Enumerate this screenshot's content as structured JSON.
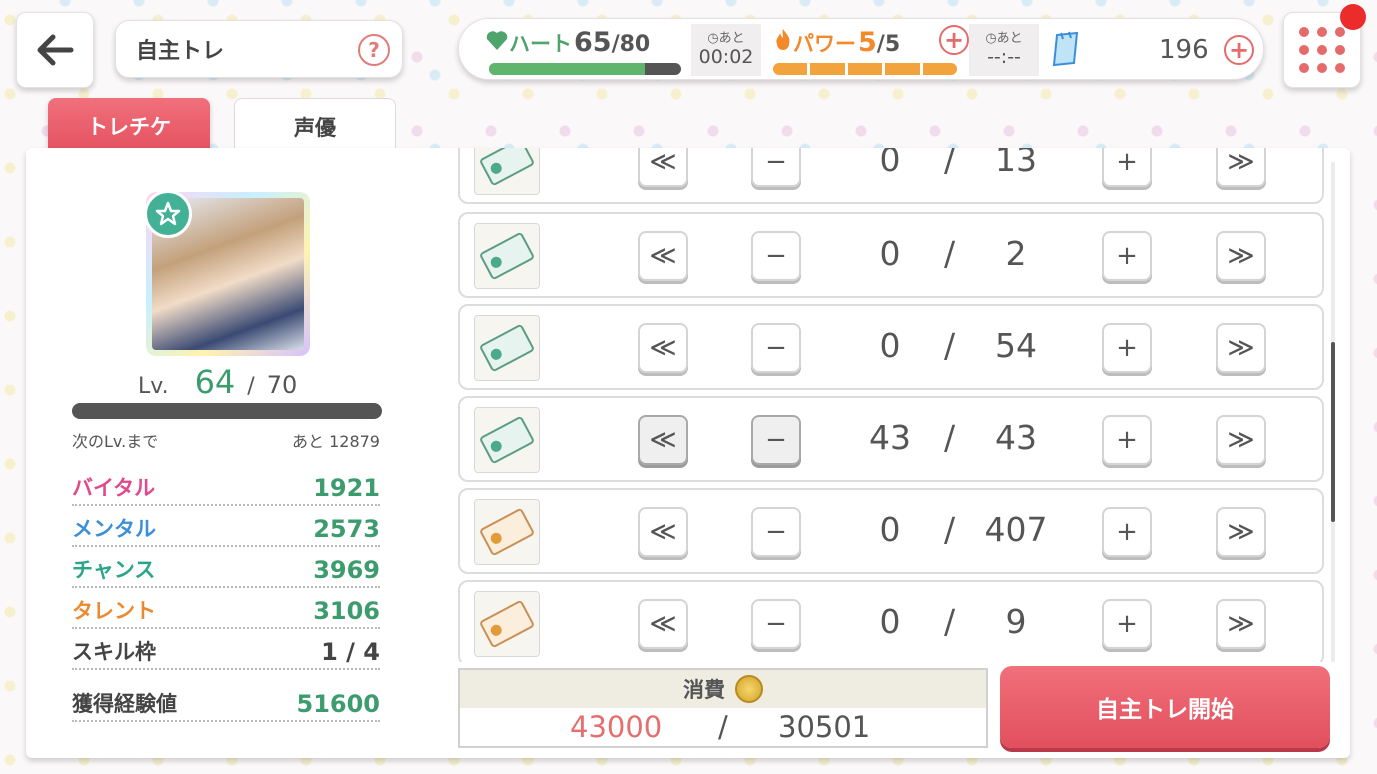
{
  "header": {
    "title": "自主トレ",
    "help_label": "?",
    "heart": {
      "label": "ハート",
      "current": "65",
      "max": "/80",
      "fill": 0.8125
    },
    "heart_timer": {
      "label": "あと",
      "time": "00:02"
    },
    "power": {
      "label": "パワー",
      "current": "5",
      "max": "/5",
      "segments": 5,
      "filled": 5
    },
    "power_timer": {
      "label": "あと",
      "time": "--:--"
    },
    "currency": "196",
    "plus_label": "+"
  },
  "tabs": [
    {
      "label": "トレチケ",
      "active": true
    },
    {
      "label": "声優",
      "active": false
    }
  ],
  "character": {
    "level_label": "Lv.",
    "level": "64",
    "level_sep": "/",
    "level_max": "70",
    "exp_fill": 0.0,
    "next_label": "次のLv.まで",
    "next_value": "あと 12879",
    "stats": [
      {
        "name": "バイタル",
        "value": "1921",
        "name_color": "#e0498b",
        "value_color": "#3d9c6d"
      },
      {
        "name": "メンタル",
        "value": "2573",
        "name_color": "#3b8fd9",
        "value_color": "#3d9c6d"
      },
      {
        "name": "チャンス",
        "value": "3969",
        "name_color": "#2aa58a",
        "value_color": "#3d9c6d"
      },
      {
        "name": "タレント",
        "value": "3106",
        "name_color": "#ea8a2e",
        "value_color": "#3d9c6d"
      },
      {
        "name": "スキル枠",
        "value": "1 / 4",
        "name_color": "#444444",
        "value_color": "#444444"
      },
      {
        "name": "獲得経験値",
        "value": "51600",
        "name_color": "#444444",
        "value_color": "#3d9c6d"
      }
    ]
  },
  "tickets": {
    "buttons": {
      "min": "≪",
      "minus": "−",
      "plus": "+",
      "max": "≫"
    },
    "separator": "/",
    "rows": [
      {
        "color": "green",
        "used": "0",
        "owned": "13",
        "minus_disabled": false
      },
      {
        "color": "green",
        "used": "0",
        "owned": "2",
        "minus_disabled": false
      },
      {
        "color": "green",
        "used": "0",
        "owned": "54",
        "minus_disabled": false
      },
      {
        "color": "green",
        "used": "43",
        "owned": "43",
        "minus_disabled": true
      },
      {
        "color": "orange",
        "used": "0",
        "owned": "407",
        "minus_disabled": false
      },
      {
        "color": "orange",
        "used": "0",
        "owned": "9",
        "minus_disabled": false
      }
    ]
  },
  "footer": {
    "cost_label": "消費",
    "cost_needed": "43000",
    "cost_separator": "/",
    "cost_owned": "30501",
    "start_label": "自主トレ開始"
  },
  "colors": {
    "accent": "#e4505e",
    "heart": "#5fb56c",
    "power": "#f2a33c",
    "level": "#3d9c6d",
    "shortfall": "#e56f6f"
  }
}
